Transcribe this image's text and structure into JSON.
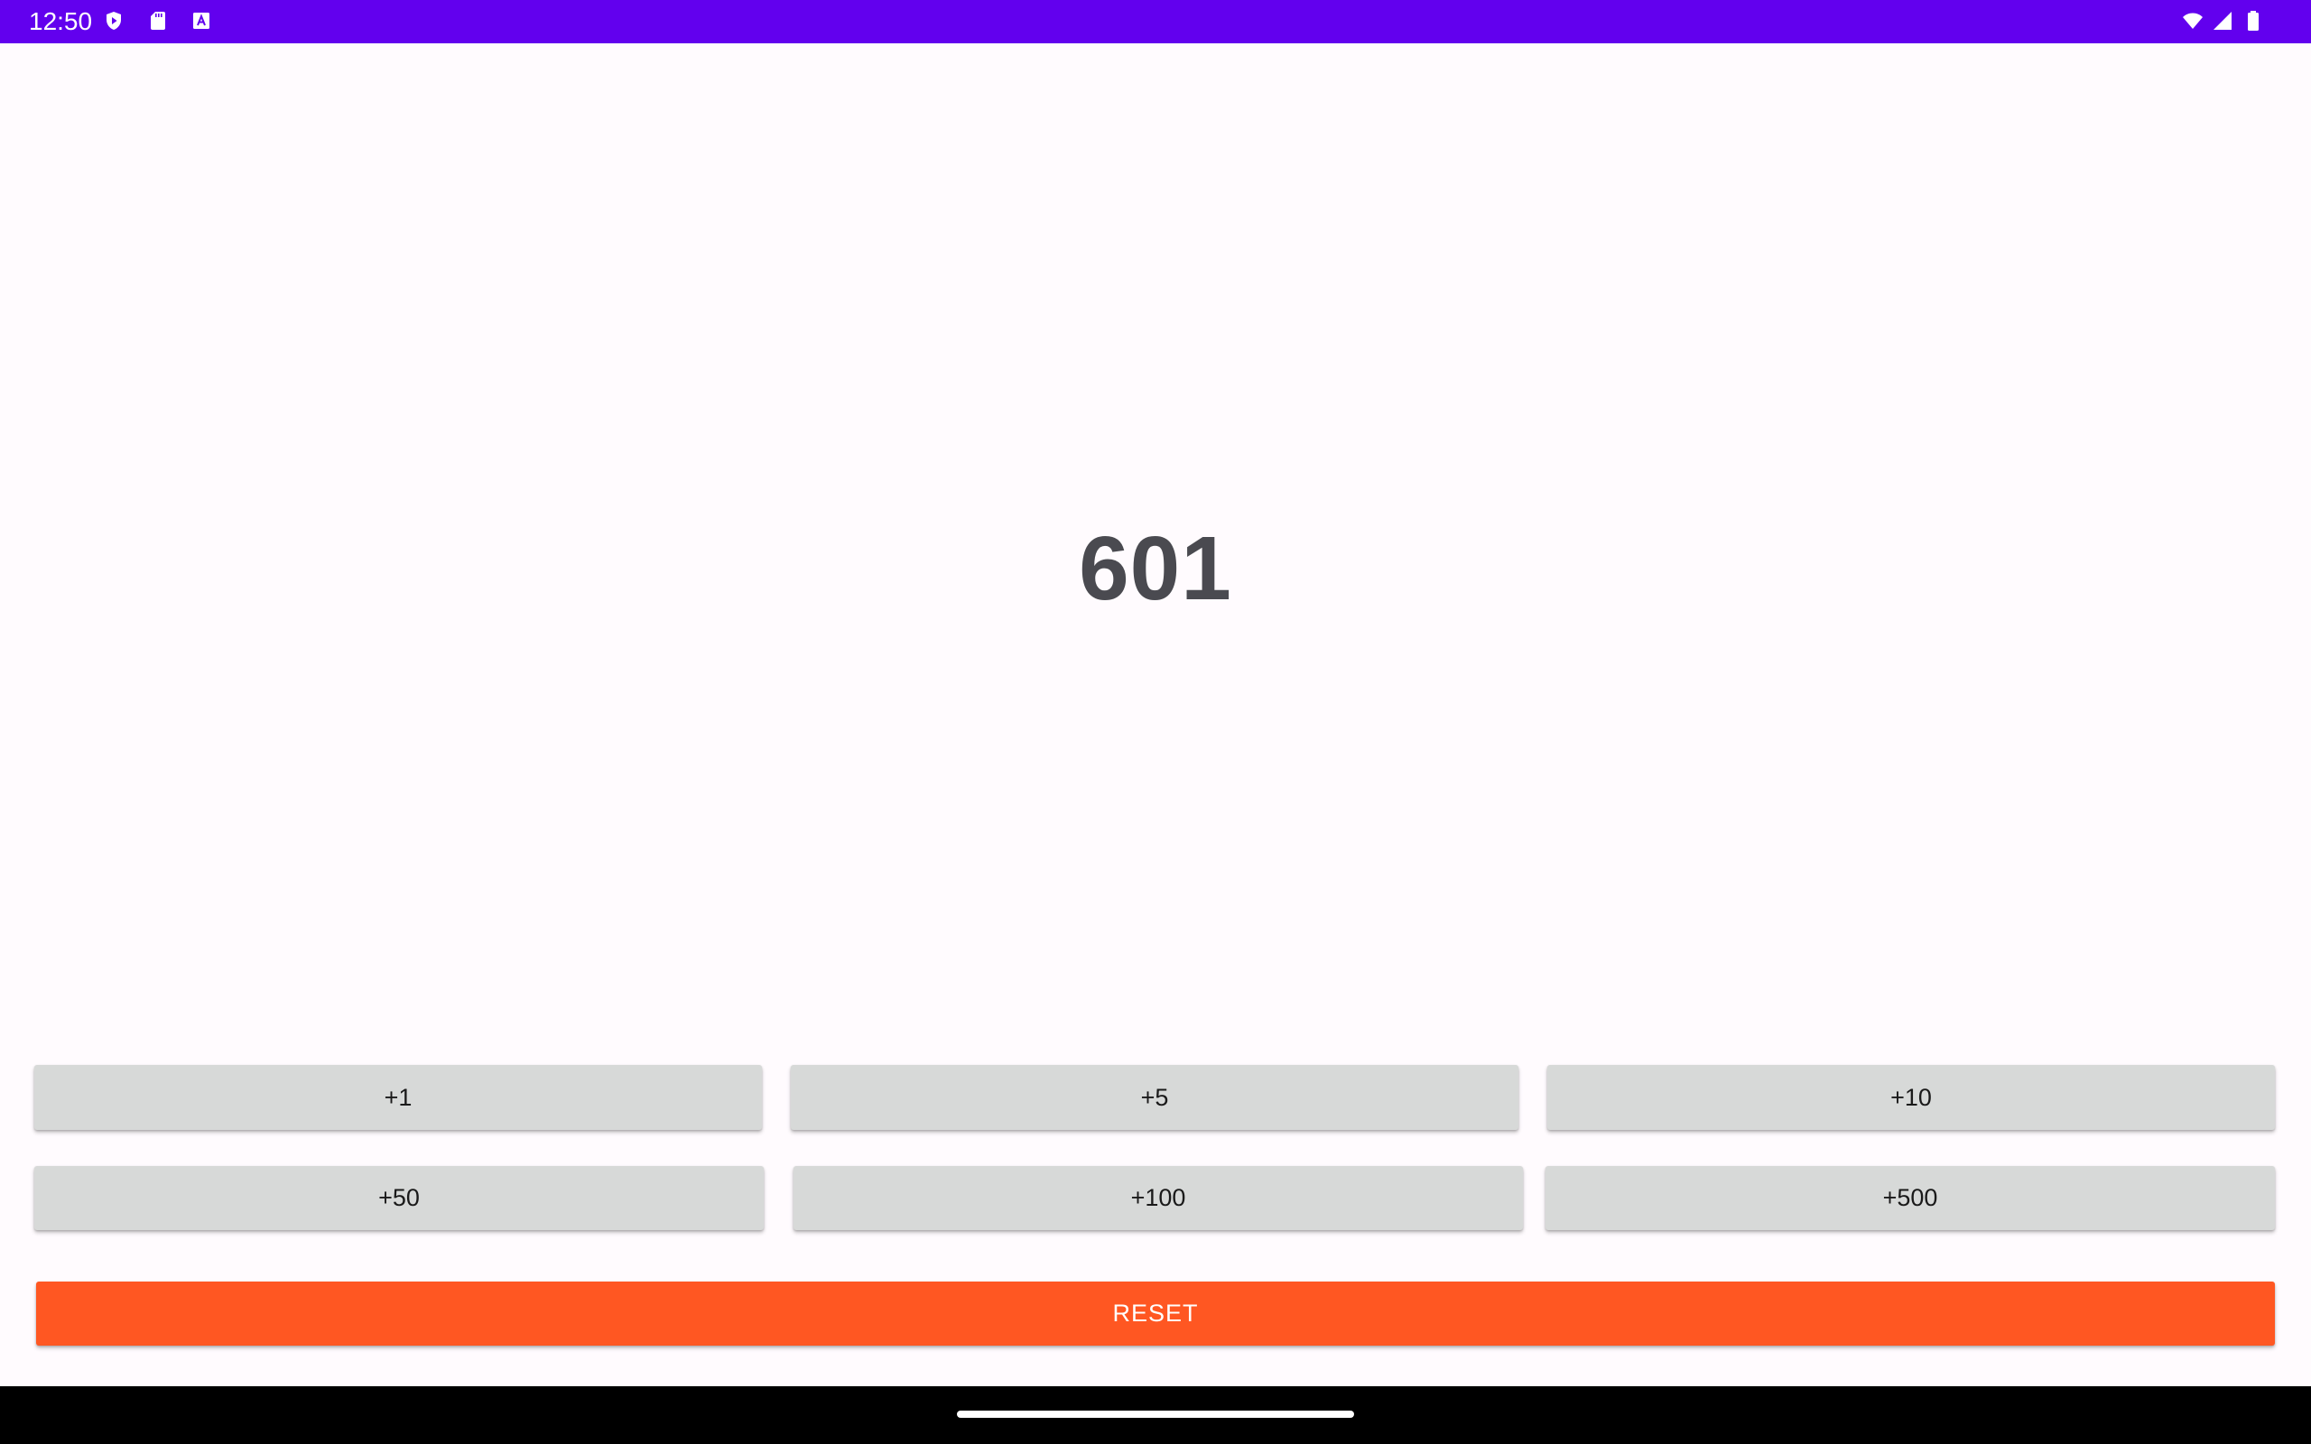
{
  "status_bar": {
    "time": "12:50",
    "background": "#6200ee",
    "left_icons": [
      "play-protect-icon",
      "sd-card-icon",
      "a-notification-icon"
    ],
    "right_icons": [
      "wifi-icon",
      "cell-signal-icon",
      "battery-icon"
    ]
  },
  "counter": {
    "value": "601"
  },
  "buttons": {
    "row1": [
      {
        "label": "+1"
      },
      {
        "label": "+5"
      },
      {
        "label": "+10"
      }
    ],
    "row2": [
      {
        "label": "+50"
      },
      {
        "label": "+100"
      },
      {
        "label": "+500"
      }
    ],
    "reset": {
      "label": "RESET",
      "color": "#ff5722"
    }
  },
  "colors": {
    "button_bg": "#d7d9d8",
    "counter_text": "#4a4a50",
    "page_bg": "#fffbfe"
  }
}
